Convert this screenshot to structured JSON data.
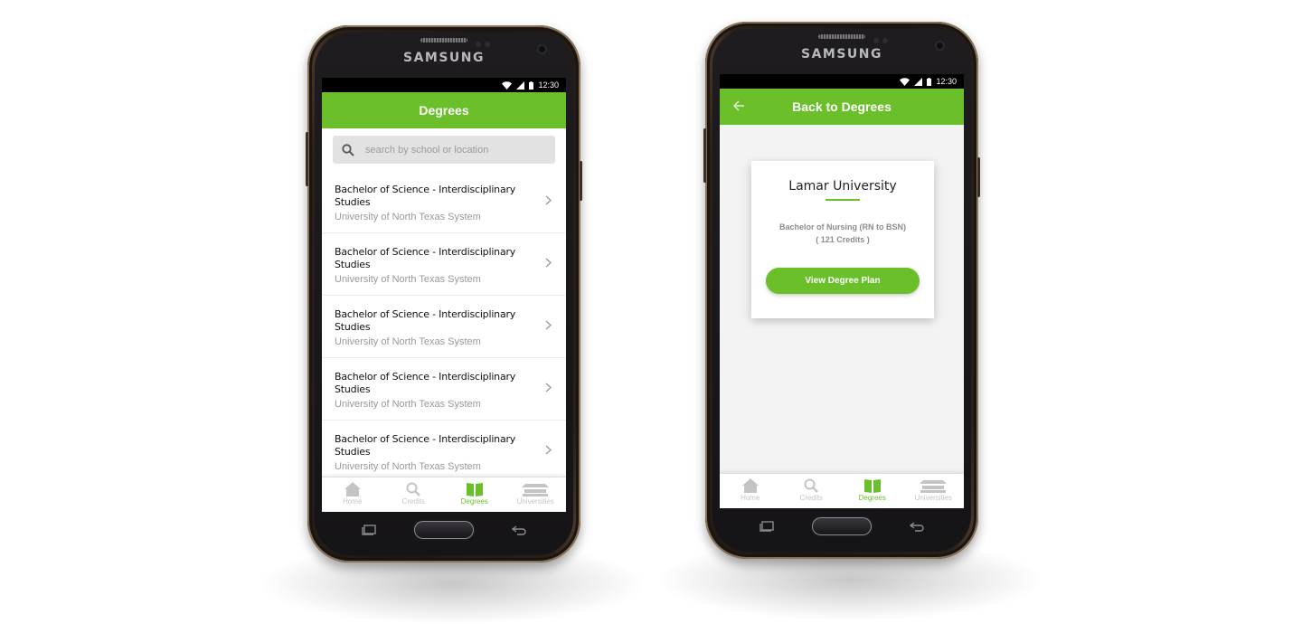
{
  "device_brand": "SAMSUNG",
  "status_time": "12:30",
  "colors": {
    "accent": "#6abf2a",
    "tab_inactive": "#c4c4c4"
  },
  "phone1": {
    "title": "Degrees",
    "search": {
      "placeholder": "search by school or location"
    },
    "items": [
      {
        "title": "Bachelor of Science - Interdisciplinary Studies",
        "subtitle": "University of North Texas System"
      },
      {
        "title": "Bachelor of Science - Interdisciplinary Studies",
        "subtitle": "University of North Texas System"
      },
      {
        "title": "Bachelor of Science - Interdisciplinary Studies",
        "subtitle": "University of North Texas System"
      },
      {
        "title": "Bachelor of Science - Interdisciplinary Studies",
        "subtitle": "University of North Texas System"
      },
      {
        "title": "Bachelor of Science - Interdisciplinary Studies",
        "subtitle": "University of North Texas System"
      }
    ]
  },
  "phone2": {
    "title": "Back to Degrees",
    "card": {
      "university": "Lamar University",
      "degree": "Bachelor of Nursing (RN to BSN)",
      "credits": "( 121 Credits )",
      "button": "View Degree Plan"
    }
  },
  "tabs": [
    {
      "label": "Home",
      "icon": "home-icon"
    },
    {
      "label": "Credits",
      "icon": "search-icon"
    },
    {
      "label": "Degrees",
      "icon": "book-icon",
      "active": true
    },
    {
      "label": "Universities",
      "icon": "university-icon"
    }
  ]
}
